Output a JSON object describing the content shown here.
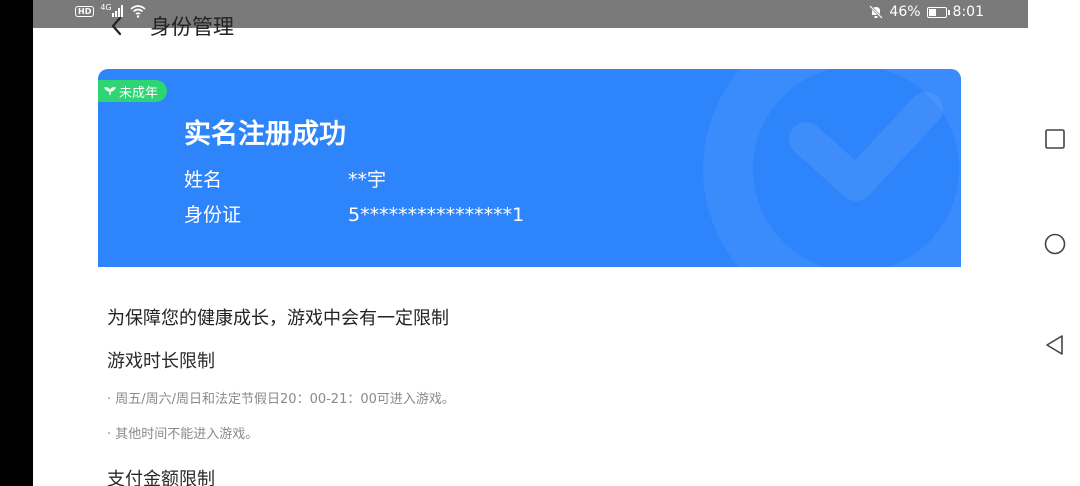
{
  "status_bar": {
    "left_badge": "HD",
    "network": "4G",
    "battery_text": "46%",
    "battery_level": 0.46,
    "time": "8:01"
  },
  "header": {
    "title": "身份管理",
    "back_icon": "chevron-left-icon"
  },
  "card": {
    "badge": "未成年",
    "heading": "实名注册成功",
    "name_label": "姓名",
    "name_value": "**宇",
    "id_label": "身份证",
    "id_value": "5****************1",
    "background_color": "#2e84fb",
    "badge_color": "#2ed573"
  },
  "content": {
    "intro": "为保障您的健康成长，游戏中会有一定限制",
    "section_playtime_title": "游戏时长限制",
    "rule_1": "· 周五/周六/周日和法定节假日20：00-21：00可进入游戏。",
    "rule_2": "· 其他时间不能进入游戏。",
    "section_payment_title": "支付金额限制"
  },
  "nav_bar": {
    "recents_icon": "square-icon",
    "home_icon": "circle-icon",
    "back_icon": "triangle-back-icon"
  }
}
